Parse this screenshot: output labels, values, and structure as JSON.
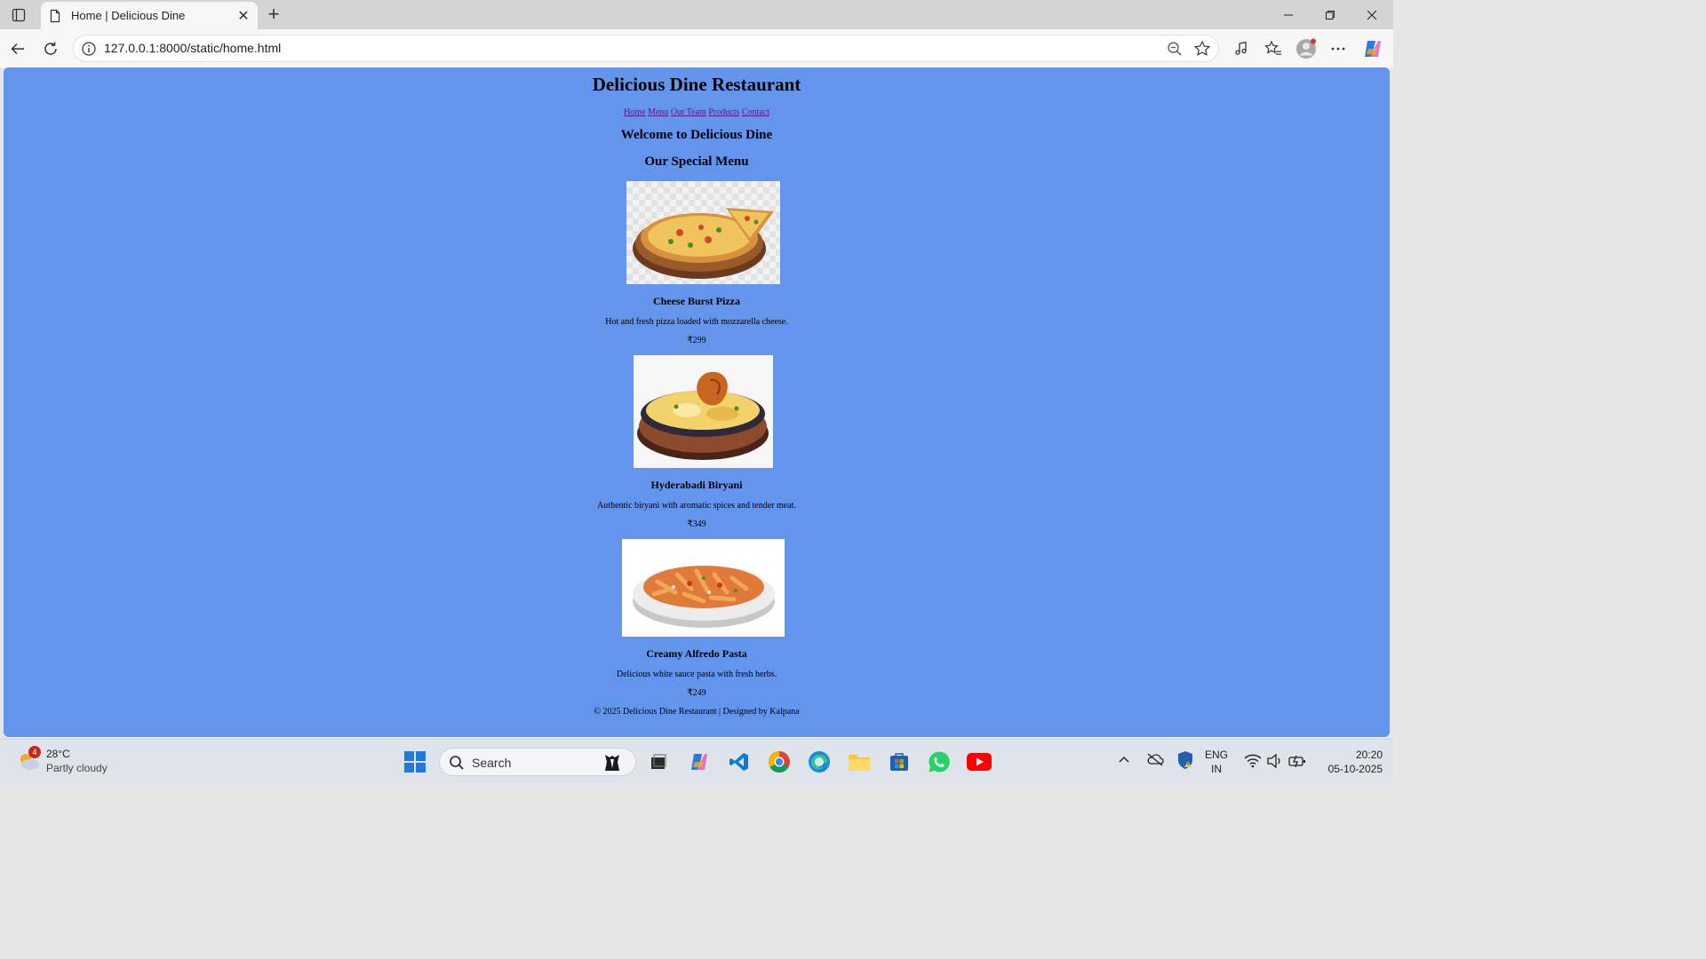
{
  "browser": {
    "tab_title": "Home | Delicious Dine",
    "tab_close": "✕",
    "new_tab": "+",
    "url": "127.0.0.1:8000/static/home.html"
  },
  "page": {
    "background_color": "#6495ed",
    "site_title": "Delicious Dine Restaurant",
    "nav": [
      "Home",
      "Menu",
      "Our Team",
      "Products",
      "Contact"
    ],
    "welcome": "Welcome to Delicious Dine",
    "section_title": "Our Special Menu",
    "dishes": [
      {
        "name": "Cheese Burst Pizza",
        "description": "Hot and fresh pizza loaded with mozzarella cheese.",
        "price": "₹299"
      },
      {
        "name": "Hyderabadi Biryani",
        "description": "Authentic biryani with aromatic spices and tender meat.",
        "price": "₹349"
      },
      {
        "name": "Creamy Alfredo Pasta",
        "description": "Delicious white sauce pasta with fresh herbs.",
        "price": "₹249"
      }
    ],
    "footer": "© 2025 Delicious Dine Restaurant | Designed by Kalpana"
  },
  "taskbar": {
    "weather_temp": "28°C",
    "weather_condition": "Partly cloudy",
    "weather_badge": "4",
    "search_label": "Search",
    "lang_line1": "ENG",
    "lang_line2": "IN",
    "time": "20:20",
    "date": "05-10-2025"
  }
}
